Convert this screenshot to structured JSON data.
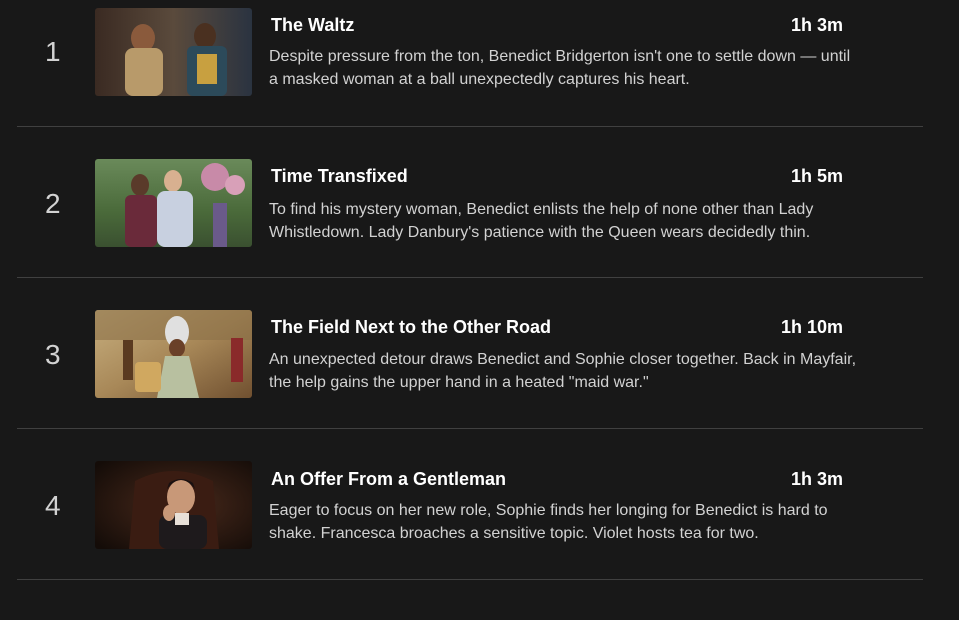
{
  "episodes": [
    {
      "index": "1",
      "title": "The Waltz",
      "duration": "1h 3m",
      "synopsis": "Despite pressure from the ton, Benedict Bridgerton isn't one to settle down — until a masked woman at a ball unexpectedly captures his heart.",
      "thumbnail": "masked-couple-at-ball"
    },
    {
      "index": "2",
      "title": "Time Transfixed",
      "duration": "1h 5m",
      "synopsis": "To find his mystery woman, Benedict enlists the help of none other than Lady Whistledown. Lady Danbury's patience with the Queen wears decidedly thin.",
      "thumbnail": "two-ladies-in-garden"
    },
    {
      "index": "3",
      "title": "The Field Next to the Other Road",
      "duration": "1h 10m",
      "synopsis": "An unexpected detour draws Benedict and Sophie closer together. Back in Mayfair, the help gains the upper hand in a heated \"maid war.\"",
      "thumbnail": "queen-in-ornate-room"
    },
    {
      "index": "4",
      "title": "An Offer From a Gentleman",
      "duration": "1h 3m",
      "synopsis": "Eager to focus on her new role, Sophie finds her longing for Benedict is hard to shake. Francesca broaches a sensitive topic. Violet hosts tea for two.",
      "thumbnail": "gentleman-in-leather-chair"
    }
  ]
}
